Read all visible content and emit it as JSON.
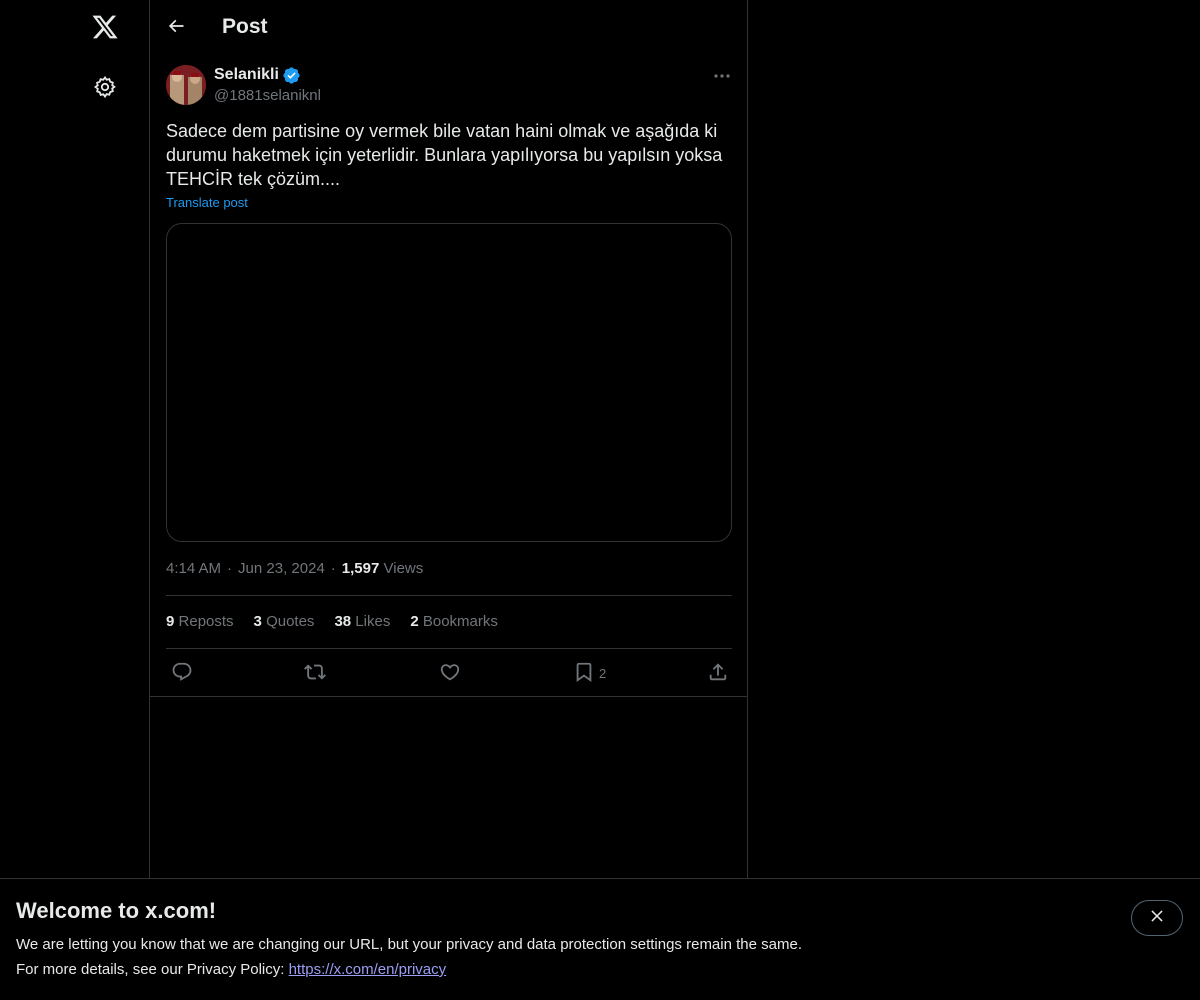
{
  "nav": {
    "logo_icon": "x-logo-icon",
    "settings_icon": "gear-icon"
  },
  "header": {
    "back_icon": "arrow-left-icon",
    "title": "Post"
  },
  "post": {
    "author": {
      "name": "Selanikli",
      "handle": "@1881selaniknl",
      "verified": true
    },
    "text": "Sadece dem partisine oy vermek bile vatan haini olmak ve aşağıda ki durumu haketmek için yeterlidir. Bunlara yapılıyorsa bu yapılsın yoksa TEHCİR tek çözüm....",
    "translate_label": "Translate post",
    "time": "4:14 AM",
    "date": "Jun 23, 2024",
    "views_count": "1,597",
    "views_label": "Views",
    "stats": {
      "reposts_count": "9",
      "reposts_label": "Reposts",
      "quotes_count": "3",
      "quotes_label": "Quotes",
      "likes_count": "38",
      "likes_label": "Likes",
      "bookmarks_count": "2",
      "bookmarks_label": "Bookmarks"
    },
    "actions": {
      "bookmark_count": "2"
    }
  },
  "banner": {
    "title": "Welcome to x.com!",
    "line1": "We are letting you know that we are changing our URL, but your privacy and data protection settings remain the same.",
    "line2_prefix": "For more details, see our Privacy Policy: ",
    "link_text": "https://x.com/en/privacy"
  },
  "colors": {
    "background": "#000000",
    "text": "#e7e9ea",
    "muted": "#71767b",
    "accent": "#1d9bf0",
    "border": "#2f3336"
  }
}
